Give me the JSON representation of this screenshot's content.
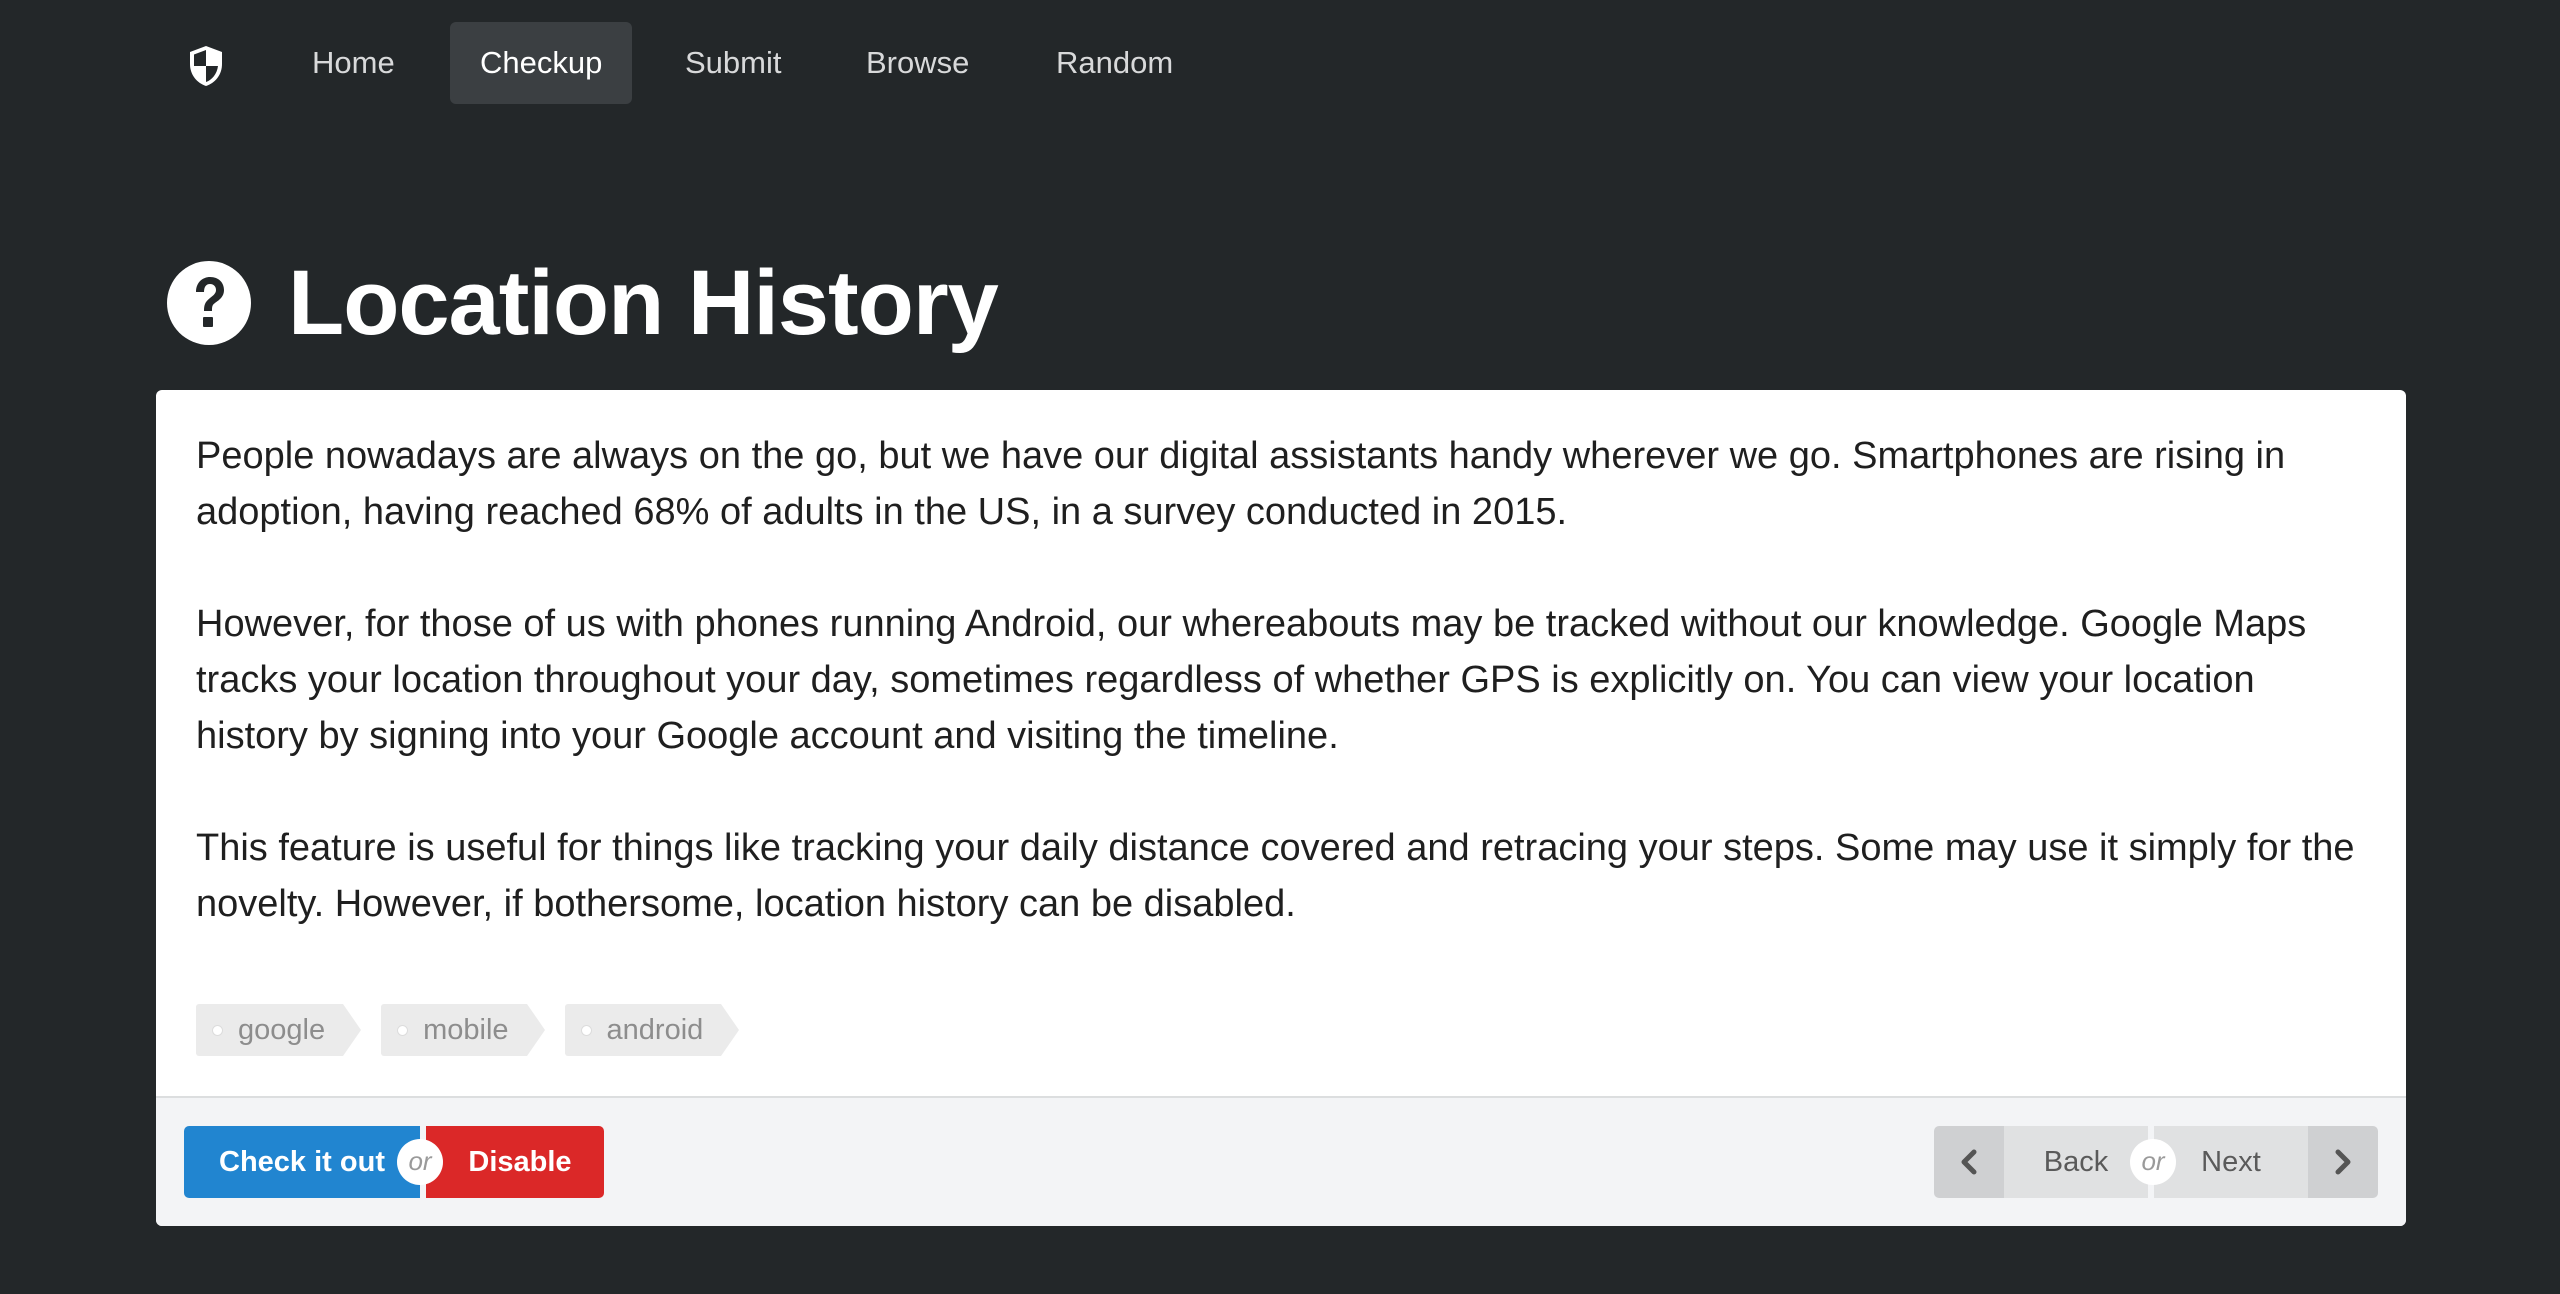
{
  "nav": {
    "logo_icon": "shield-icon",
    "items": [
      {
        "label": "Home",
        "active": false
      },
      {
        "label": "Checkup",
        "active": true
      },
      {
        "label": "Submit",
        "active": false
      },
      {
        "label": "Browse",
        "active": false
      },
      {
        "label": "Random",
        "active": false
      }
    ]
  },
  "page": {
    "title_icon": "question-circle-icon",
    "title": "Location History"
  },
  "content": {
    "paragraphs": [
      "People nowadays are always on the go, but we have our digital assistants handy wherever we go. Smartphones are rising in adoption, having reached 68% of adults in the US, in a survey conducted in 2015.",
      "However, for those of us with phones running Android, our whereabouts may be tracked without our knowledge. Google Maps tracks your location throughout your day, sometimes regardless of whether GPS is explicitly on. You can view your location history by signing into your Google account and visiting the timeline.",
      "This feature is useful for things like tracking your daily distance covered and retracing your steps. Some may use it simply for the novelty. However, if bothersome, location history can be disabled."
    ],
    "tags": [
      "google",
      "mobile",
      "android"
    ]
  },
  "actions": {
    "check_label": "Check it out",
    "or_label": "or",
    "disable_label": "Disable",
    "back_label": "Back",
    "next_label": "Next",
    "back_icon": "chevron-left-icon",
    "next_icon": "chevron-right-icon"
  },
  "colors": {
    "background": "#232729",
    "primary": "#2185d0",
    "danger": "#db2828",
    "nav_active": "#3b3f42"
  }
}
